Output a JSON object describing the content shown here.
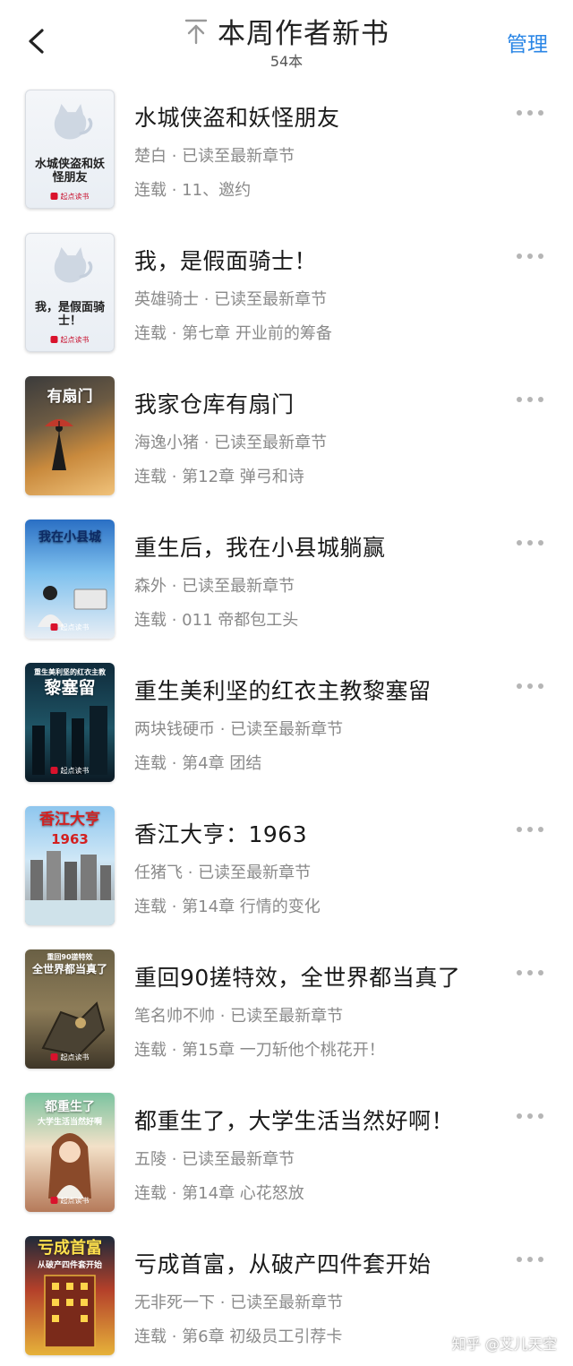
{
  "header": {
    "title": "本周作者新书",
    "count": "54本",
    "manage_label": "管理"
  },
  "books": [
    {
      "title": "水城侠盗和妖怪朋友",
      "author_line": "楚白 · 已读至最新章节",
      "status_line": "连载 · 11、邀约",
      "cover_text": "水城侠盗和妖怪朋友",
      "cover_publisher": "起点读书",
      "cover_style": "placeholder"
    },
    {
      "title": "我，是假面骑士！",
      "author_line": "英雄骑士 · 已读至最新章节",
      "status_line": "连载 · 第七章 开业前的筹备",
      "cover_text": "我，是假面骑士！",
      "cover_publisher": "起点读书",
      "cover_style": "placeholder"
    },
    {
      "title": "我家仓库有扇门",
      "author_line": "海逸小猪 · 已读至最新章节",
      "status_line": "连载 · 第12章 弹弓和诗",
      "cover_text": "有扇门",
      "cover_publisher": "",
      "cover_style": "rain"
    },
    {
      "title": "重生后，我在小县城躺赢",
      "author_line": "森外 · 已读至最新章节",
      "status_line": "连载 · 011 帝都包工头",
      "cover_text": "我在小县城",
      "cover_publisher": "起点读书",
      "cover_style": "office"
    },
    {
      "title": "重生美利坚的红衣主教黎塞留",
      "author_line": "两块钱硬币 · 已读至最新章节",
      "status_line": "连载 · 第4章 团结",
      "cover_text": "黎塞留",
      "cover_subtext": "重生美利坚的红衣主教",
      "cover_publisher": "起点读书",
      "cover_style": "city-dark"
    },
    {
      "title": "香江大亨：1963",
      "author_line": "任猪飞 · 已读至最新章节",
      "status_line": "连载 · 第14章 行情的变化",
      "cover_text": "香江大亨",
      "cover_subtext": "1963",
      "cover_publisher": "",
      "cover_style": "harbor"
    },
    {
      "title": "重回90搓特效，全世界都当真了",
      "author_line": "笔名帅不帅 · 已读至最新章节",
      "status_line": "连载 · 第15章 一刀斩他个桃花开！",
      "cover_text": "全世界都当真了",
      "cover_subtext": "重回90搓特效",
      "cover_publisher": "起点读书",
      "cover_style": "mecha"
    },
    {
      "title": "都重生了，大学生活当然好啊！",
      "author_line": "五陵 · 已读至最新章节",
      "status_line": "连载 · 第14章 心花怒放",
      "cover_text": "都重生了",
      "cover_subtext": "大学生活当然好啊",
      "cover_publisher": "起点读书",
      "cover_style": "girl"
    },
    {
      "title": "亏成首富，从破产四件套开始",
      "author_line": "无非死一下 · 已读至最新章节",
      "status_line": "连载 · 第6章 初级员工引荐卡",
      "cover_text": "亏成首富",
      "cover_subtext": "从破产四件套开始",
      "cover_publisher": "",
      "cover_style": "tower"
    }
  ],
  "watermark": "知乎 @艾儿天空"
}
